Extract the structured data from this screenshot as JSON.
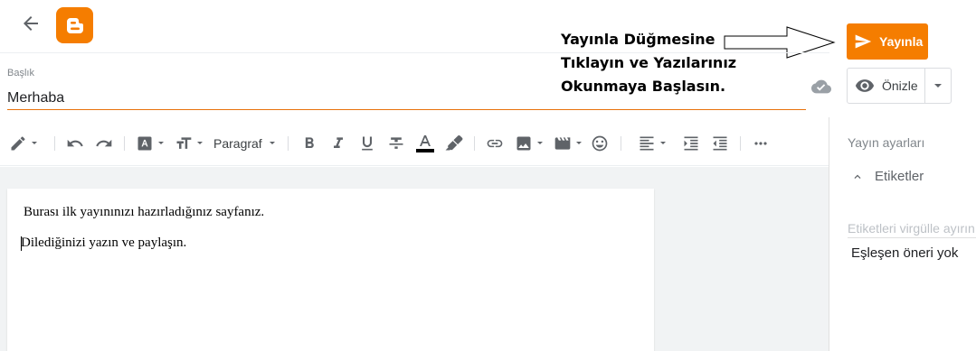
{
  "header": {
    "back_icon": "arrow-back-icon",
    "logo_icon": "blogger-logo-icon"
  },
  "annotation": {
    "lines": [
      "Yayınla Düğmesine",
      "Tıklayın ve Yazılarınız",
      "Okunmaya Başlasın."
    ]
  },
  "actions": {
    "publish_label": "Yayınla",
    "preview_label": "Önizle"
  },
  "title": {
    "label": "Başlık",
    "value": "Merhaba"
  },
  "toolbar": {
    "paragraph_label": "Paragraf",
    "icons": [
      "pencil-icon",
      "undo-icon",
      "redo-icon",
      "font-icon",
      "font-size-icon",
      "bold-icon",
      "italic-icon",
      "underline-icon",
      "strikethrough-icon",
      "text-color-icon",
      "highlight-icon",
      "link-icon",
      "image-icon",
      "video-icon",
      "emoji-icon",
      "align-icon",
      "indent-icon",
      "outdent-icon",
      "more-icon"
    ]
  },
  "editor": {
    "line1": "Burası ilk yayınınızı hazırladığınız sayfanız.",
    "line2": "Dilediğinizi yazın ve paylaşın."
  },
  "sidebar": {
    "settings_label": "Yayın ayarları",
    "tags_label": "Etiketler",
    "tags_placeholder": "Etiketleri virgülle ayırın",
    "no_match": "Eşleşen öneri yok"
  },
  "colors": {
    "accent": "#f57d00",
    "title_underline": "#e8710a",
    "icon_gray": "#5f6368"
  }
}
